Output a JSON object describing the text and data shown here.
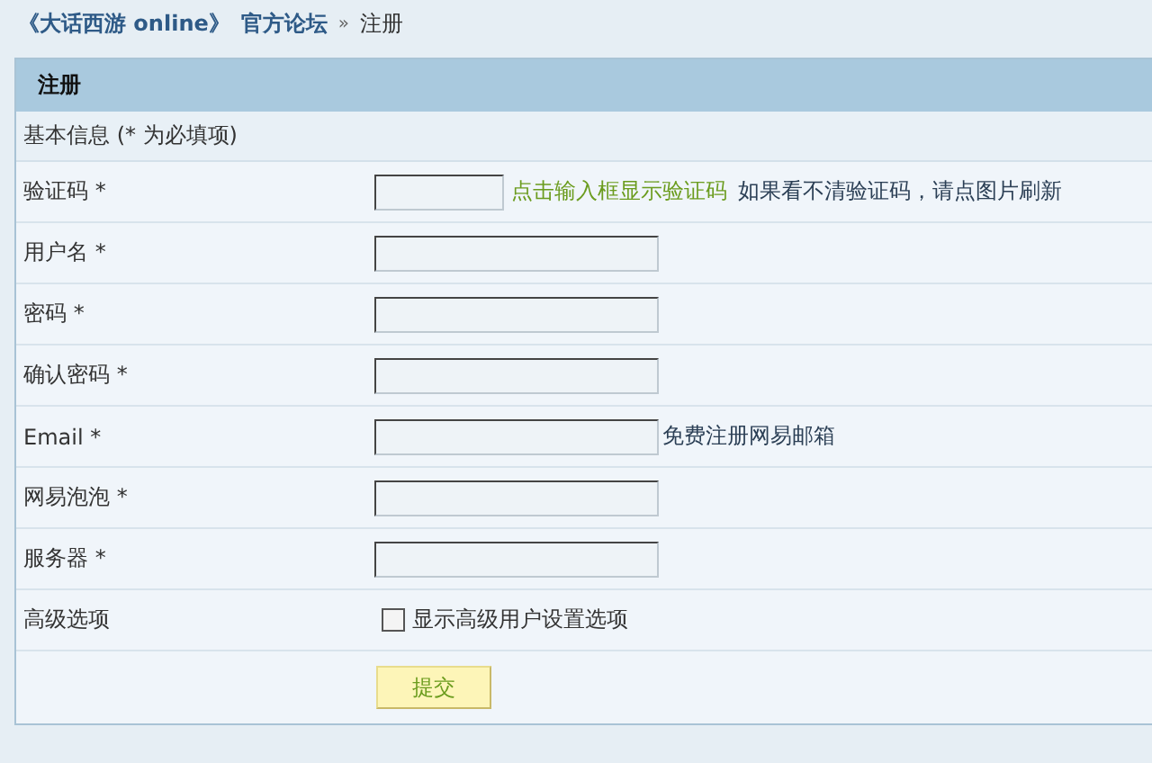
{
  "breadcrumb": {
    "forum": "《大话西游 online》",
    "board": "官方论坛",
    "separator": "»",
    "current": "注册"
  },
  "panel": {
    "title": "注册",
    "section": "基本信息 (* 为必填项)",
    "rows": [
      {
        "kind": "captcha",
        "label": "验证码 *",
        "hint_link": "点击输入框显示验证码",
        "hint": "如果看不清验证码，请点图片刷新"
      },
      {
        "kind": "text",
        "label": "用户名 *"
      },
      {
        "kind": "text",
        "label": "密码 *"
      },
      {
        "kind": "text",
        "label": "确认密码 *"
      },
      {
        "kind": "text",
        "label": "Email *",
        "link": "免费注册网易邮箱"
      },
      {
        "kind": "text",
        "label": "网易泡泡 *"
      },
      {
        "kind": "text",
        "label": "服务器 *"
      },
      {
        "kind": "checkbox",
        "label": "高级选项",
        "option": "显示高级用户设置选项",
        "checked": false
      }
    ],
    "submit": "提交"
  }
}
